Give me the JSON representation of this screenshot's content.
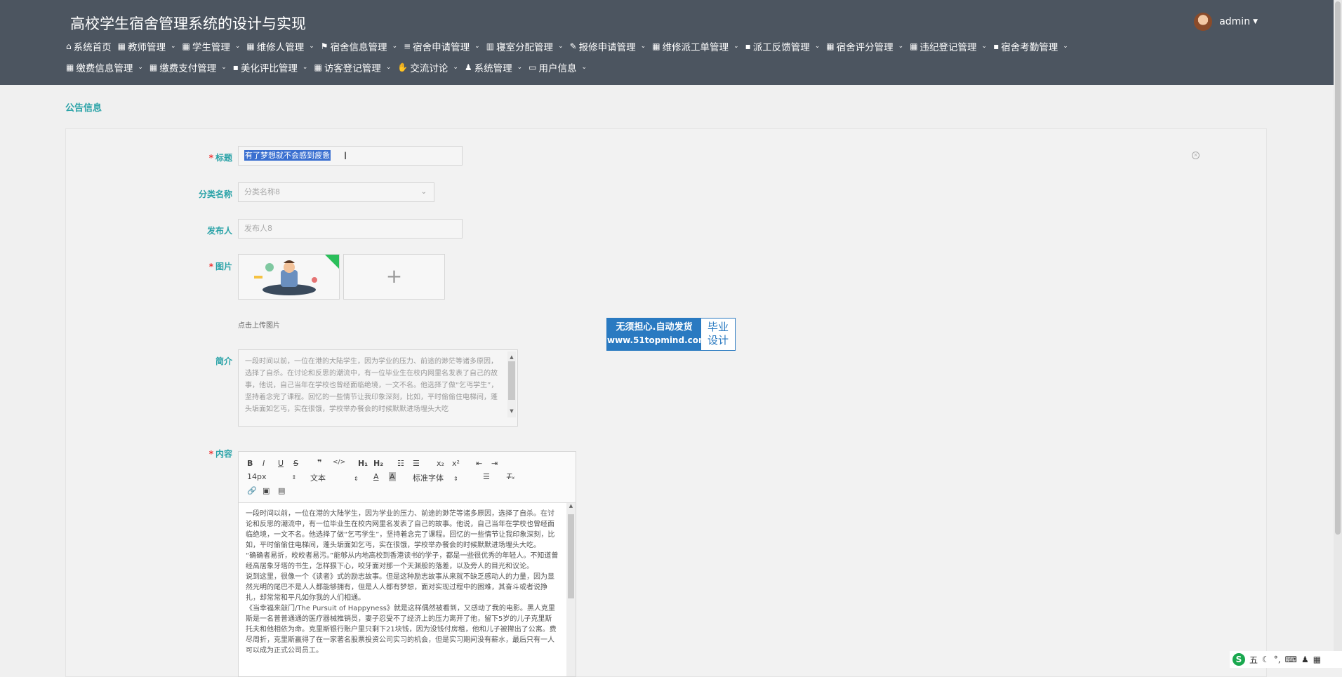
{
  "app": {
    "title": "高校学生宿舍管理系统的设计与实现",
    "user": "admin"
  },
  "nav": [
    {
      "label": "系统首页",
      "icon": "home-icon",
      "glyph": "⌂",
      "caret": false
    },
    {
      "label": "教师管理",
      "icon": "grid-icon",
      "glyph": "▦",
      "caret": true
    },
    {
      "label": "学生管理",
      "icon": "grid-icon",
      "glyph": "▦",
      "caret": true
    },
    {
      "label": "维修人管理",
      "icon": "grid-icon",
      "glyph": "▦",
      "caret": true
    },
    {
      "label": "宿舍信息管理",
      "icon": "flag-icon",
      "glyph": "⚑",
      "caret": true
    },
    {
      "label": "宿舍申请管理",
      "icon": "list-icon",
      "glyph": "≡",
      "caret": true
    },
    {
      "label": "寝室分配管理",
      "icon": "bar-chart-icon",
      "glyph": "▥",
      "caret": true
    },
    {
      "label": "报修申请管理",
      "icon": "edit-icon",
      "glyph": "✎",
      "caret": true
    },
    {
      "label": "维修派工单管理",
      "icon": "grid-icon",
      "glyph": "▦",
      "caret": true
    },
    {
      "label": "派工反馈管理",
      "icon": "comment-icon",
      "glyph": "▪",
      "caret": true
    },
    {
      "label": "宿舍评分管理",
      "icon": "grid-icon",
      "glyph": "▦",
      "caret": true
    },
    {
      "label": "违纪登记管理",
      "icon": "grid-icon",
      "glyph": "▦",
      "caret": true
    },
    {
      "label": "宿舍考勤管理",
      "icon": "comment-icon",
      "glyph": "▪",
      "caret": true
    },
    {
      "label": "缴费信息管理",
      "icon": "grid-icon",
      "glyph": "▦",
      "caret": true
    },
    {
      "label": "缴费支付管理",
      "icon": "grid-icon",
      "glyph": "▦",
      "caret": true
    },
    {
      "label": "美化评比管理",
      "icon": "comment-icon",
      "glyph": "▪",
      "caret": true
    },
    {
      "label": "访客登记管理",
      "icon": "grid-icon",
      "glyph": "▦",
      "caret": true
    },
    {
      "label": "交流讨论",
      "icon": "thumbs-up-icon",
      "glyph": "✋",
      "caret": true
    },
    {
      "label": "系统管理",
      "icon": "user-icon",
      "glyph": "♟",
      "caret": true
    },
    {
      "label": "用户信息",
      "icon": "id-card-icon",
      "glyph": "▭",
      "caret": true
    }
  ],
  "page": {
    "breadcrumb": "公告信息"
  },
  "form": {
    "title": {
      "label": "标题",
      "value": "有了梦想就不会感到疲惫"
    },
    "category": {
      "label": "分类名称",
      "placeholder": "分类名称8"
    },
    "publisher": {
      "label": "发布人",
      "placeholder": "发布人8"
    },
    "image": {
      "label": "图片",
      "hint": "点击上传图片",
      "add": "+"
    },
    "intro": {
      "label": "简介",
      "text": "一段时间以前，一位在港的大陆学生，因为学业的压力、前途的渺茫等诸多原因，选择了自杀。在讨论和反思的潮流中，有一位毕业生在校内网里名发表了自己的故事，他说，自己当年在学校也曾经面临绝境，一文不名。他选择了做“乞丐学生”，坚持着念完了课程。回忆的一些情节让我印象深刻，比如，平时偷偷住电梯间，蓬头垢面如乞丐，实在很饿，学校举办餐会的时候默默进场埋头大吃"
    },
    "content": {
      "label": "内容",
      "toolbar": {
        "size": "14px",
        "para": "文本",
        "font": "标准字体"
      },
      "paragraphs": [
        "一段时间以前，一位在港的大陆学生，因为学业的压力、前途的渺茫等诸多原因，选择了自杀。在讨论和反思的潮流中，有一位毕业生在校内网里名发表了自己的故事。他说，自己当年在学校也曾经面临绝境，一文不名。他选择了做“乞丐学生”，坚持着念完了课程。回忆的一些情节让我印象深刻，比如，平时偷偷住电梯间，蓬头垢面如乞丐，实在很饿，学校举办餐会的时候默默进场埋头大吃。",
        "“确确者易折，皎皎者易污。”能够从内地高校到香港读书的学子，都是一些很优秀的年轻人。不知道曾经高居象牙塔的书生，怎样狠下心，咬牙面对那一个天渊般的落差，以及旁人的目光和议论。",
        "说到这里，很像一个《读者》式的励志故事。但是这种励志故事从来就不缺乏感动人的力量，因为显然光明的尾巴不是人人都能够拥有，但是人人都有梦想，面对实现过程中的困难，其奋斗或者说挣扎，却常常和平凡如你我的人们相通。",
        "《当幸福来敲门/The Pursuit of Happyness》就是这样偶然被看到，又感动了我的电影。黑人克里斯是一名普普通通的医疗器械推销员，妻子忍受不了经济上的压力离开了他，留下5岁的儿子克里斯托夫和他相依为命。克里斯银行账户里只剩下21块钱，因为没钱付房租，他和儿子被撵出了公寓。费尽周折，克里斯赢得了在一家著名股票投资公司实习的机会，但是实习期间没有薪水，最后只有一人可以成为正式公司员工。"
      ]
    }
  },
  "ad": {
    "line1": "无须担心.自动发货",
    "line2": "www.51topmind.com",
    "tag1": "毕业",
    "tag2": "设计"
  },
  "tray": {
    "ime": "五",
    "icons": [
      "moon-icon",
      "punct-icon",
      "keyboard-icon",
      "user-icon",
      "grid-icon"
    ]
  }
}
